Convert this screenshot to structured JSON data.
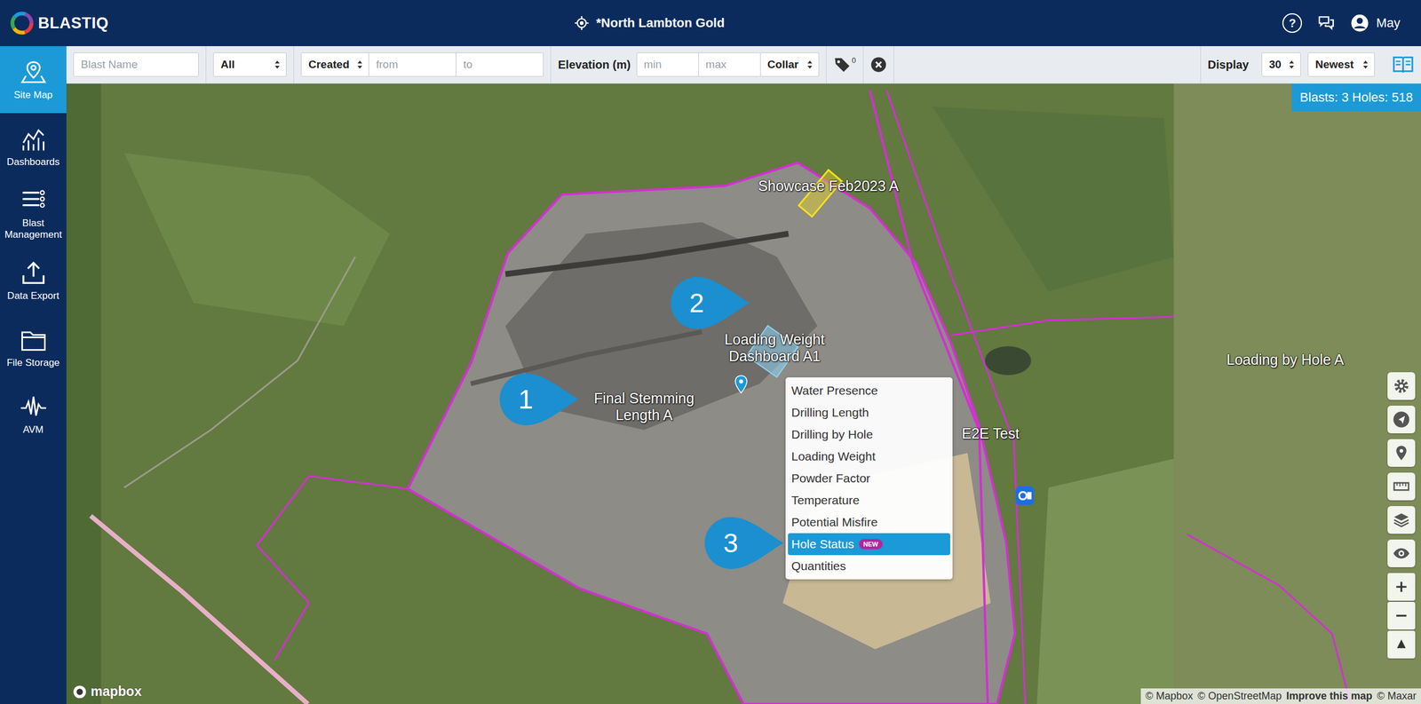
{
  "app": {
    "logo": "BLASTIQ",
    "site": "*North Lambton Gold",
    "help": "?",
    "user": "May"
  },
  "sidebar": {
    "items": [
      {
        "label": "Site Map",
        "selected": true
      },
      {
        "label": "Dashboards",
        "selected": false
      },
      {
        "label": "Blast Management",
        "selected": false
      },
      {
        "label": "Data Export",
        "selected": false
      },
      {
        "label": "File Storage",
        "selected": false
      },
      {
        "label": "AVM",
        "selected": false
      }
    ]
  },
  "filters": {
    "blast_name": {
      "placeholder": "Blast Name"
    },
    "type": {
      "value": "All"
    },
    "date_field": {
      "value": "Created"
    },
    "from": {
      "placeholder": "from"
    },
    "to": {
      "placeholder": "to"
    },
    "elevation_label": "Elevation (m)",
    "min": {
      "placeholder": "min"
    },
    "max": {
      "placeholder": "max"
    },
    "reference": {
      "value": "Collar"
    },
    "tag_count": "0",
    "display_label": "Display",
    "page_size": {
      "value": "30"
    },
    "sort": {
      "value": "Newest"
    }
  },
  "map": {
    "summary": "Blasts: 3 Holes: 518",
    "blasts": [
      {
        "name": "Showcase Feb2023 A"
      },
      {
        "name": "Loading Weight Dashboard A1"
      },
      {
        "name": "Final Stemming Length A"
      },
      {
        "name": "Loading by Hole A"
      },
      {
        "name": "E2E Test"
      }
    ],
    "callouts": [
      {
        "number": "1"
      },
      {
        "number": "2"
      },
      {
        "number": "3"
      }
    ],
    "menu": {
      "items": [
        {
          "label": "Water Presence",
          "selected": false
        },
        {
          "label": "Drilling Length",
          "selected": false
        },
        {
          "label": "Drilling by Hole",
          "selected": false
        },
        {
          "label": "Loading Weight",
          "selected": false
        },
        {
          "label": "Powder Factor",
          "selected": false
        },
        {
          "label": "Temperature",
          "selected": false
        },
        {
          "label": "Potential Misfire",
          "selected": false
        },
        {
          "label": "Hole Status",
          "selected": true,
          "badge": "NEW"
        },
        {
          "label": "Quantities",
          "selected": false
        }
      ]
    },
    "logo": "mapbox",
    "attribution": [
      {
        "text": "© Mapbox",
        "bold": false
      },
      {
        "text": "© OpenStreetMap",
        "bold": false
      },
      {
        "text": "Improve this map",
        "bold": true
      },
      {
        "text": "© Maxar",
        "bold": false
      }
    ]
  }
}
